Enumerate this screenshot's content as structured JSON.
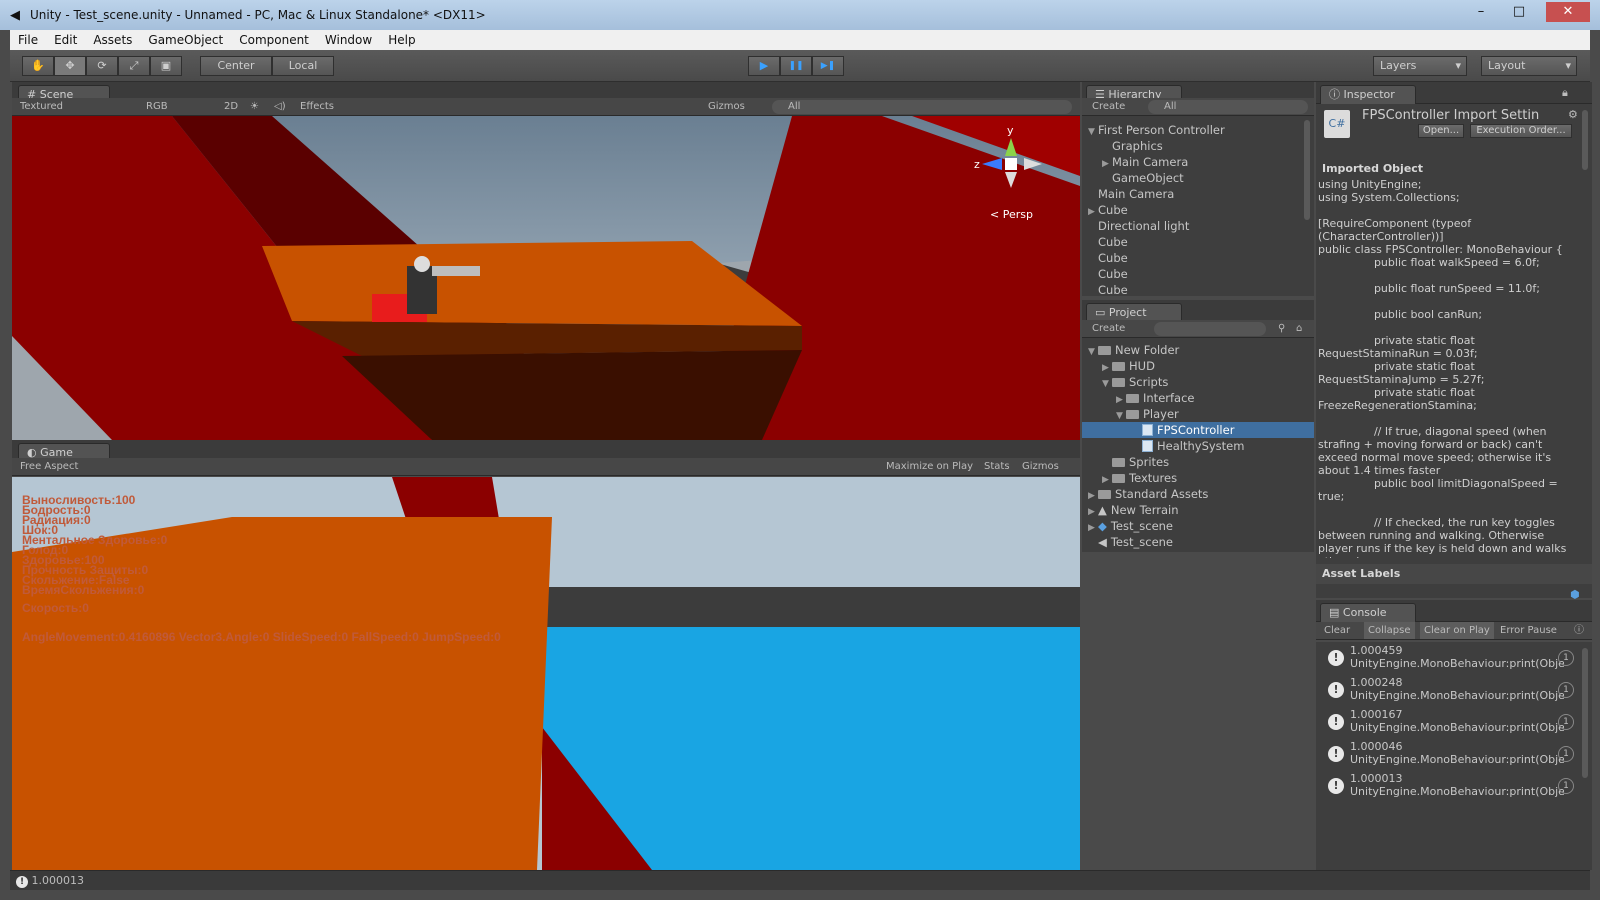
{
  "window": {
    "title": "Unity - Test_scene.unity - Unnamed - PC, Mac & Linux Standalone* <DX11>",
    "min": "–",
    "max": "□",
    "close": "✕"
  },
  "menu": [
    "File",
    "Edit",
    "Assets",
    "GameObject",
    "Component",
    "Window",
    "Help"
  ],
  "toolbar": {
    "center": "Center",
    "local": "Local",
    "layers": "Layers",
    "layout": "Layout",
    "play": "▶",
    "pause": "❚❚",
    "step": "▶❚"
  },
  "scene": {
    "tab": "Scene",
    "shading": "Textured",
    "rgb": "RGB",
    "mode2d": "2D",
    "effects": "Effects",
    "gizmos": "Gizmos",
    "search": "All",
    "persp": "Persp",
    "axis_y": "y",
    "axis_z": "z"
  },
  "game": {
    "tab": "Game",
    "aspect": "Free Aspect",
    "maximize": "Maximize on Play",
    "stats": "Stats",
    "gizmos": "Gizmos",
    "hud_lines": [
      "Выносливость:100",
      "Бодрость:0",
      "Радиация:0",
      "Шок:0",
      "Ментальное Здоровье:0",
      "Голод:0",
      "Здоровье:100",
      "Прочность Защиты:0",
      "Скольжение:False",
      "ВремяСкольжения:0"
    ],
    "speed": "Скорость:0",
    "movement": "AngleMovement:0.4160896 Vector3.Angle:0 SlideSpeed:0 FallSpeed:0 JumpSpeed:0"
  },
  "hierarchy": {
    "tab": "Hierarchy",
    "create": "Create",
    "search": "All",
    "items": [
      "First Person Controller",
      "Graphics",
      "Main Camera",
      "GameObject",
      "Main Camera",
      "Cube",
      "Directional light",
      "Cube",
      "Cube",
      "Cube",
      "Cube"
    ]
  },
  "project": {
    "tab": "Project",
    "create": "Create",
    "items": [
      "New Folder",
      "HUD",
      "Scripts",
      "Interface",
      "Player",
      "FPSController",
      "HealthySystem",
      "Sprites",
      "Textures",
      "Standard Assets",
      "New Terrain",
      "Test_scene",
      "Test_scene"
    ]
  },
  "inspector": {
    "tab": "Inspector",
    "title": "FPSController Import Settin",
    "open": "Open...",
    "exec_order": "Execution Order...",
    "imported": "Imported Object",
    "code": "using UnityEngine;\nusing System.Collections;\n\n[RequireComponent (typeof (CharacterController))]\npublic class FPSController: MonoBehaviour {\n\t\tpublic float walkSpeed = 6.0f;\n\n\t\tpublic float runSpeed = 11.0f;\n\n\t\tpublic bool canRun;\n\n\t\tprivate static float RequestStaminaRun = 0.03f;\n\t\tprivate static float RequestStaminaJump = 5.27f;\n\t\tprivate static float FreezeRegenerationStamina;\n\n\t\t// If true, diagonal speed (when strafing + moving forward or back) can't exceed normal move speed; otherwise it's about 1.4 times faster\n\t\tpublic bool limitDiagonalSpeed = true;\n\n\t\t// If checked, the run key toggles between running and walking. Otherwise player runs if the key is held down and walks otherwise",
    "asset_labels": "Asset Labels"
  },
  "console": {
    "tab": "Console",
    "clear": "Clear",
    "collapse": "Collapse",
    "clear_on_play": "Clear on Play",
    "error_pause": "Error Pause",
    "entries": [
      {
        "value": "1.000459",
        "detail": "UnityEngine.MonoBehaviour:print(Object)",
        "count": "1"
      },
      {
        "value": "1.000248",
        "detail": "UnityEngine.MonoBehaviour:print(Object)",
        "count": "1"
      },
      {
        "value": "1.000167",
        "detail": "UnityEngine.MonoBehaviour:print(Object)",
        "count": "1"
      },
      {
        "value": "1.000046",
        "detail": "UnityEngine.MonoBehaviour:print(Object)",
        "count": "1"
      },
      {
        "value": "1.000013",
        "detail": "UnityEngine.MonoBehaviour:print(Object)",
        "count": "1"
      }
    ]
  },
  "status": {
    "text": "1.000013"
  },
  "colors": {
    "accent": "#3aa1ff",
    "red": "#8b0000",
    "orange": "#c85200",
    "blue": "#19a5e3"
  }
}
